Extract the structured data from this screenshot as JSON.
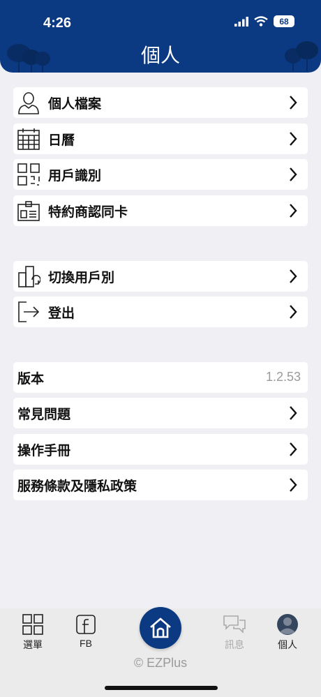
{
  "status_bar": {
    "time": "4:26",
    "battery": "68"
  },
  "header": {
    "title": "個人"
  },
  "group1": [
    {
      "label": "個人檔案",
      "icon": "person-icon"
    },
    {
      "label": "日曆",
      "icon": "calendar-icon"
    },
    {
      "label": "用戶識別",
      "icon": "qr-code-icon"
    },
    {
      "label": "特約商認同卡",
      "icon": "id-card-icon"
    }
  ],
  "group2": [
    {
      "label": "切換用戶別",
      "icon": "switch-user-icon"
    },
    {
      "label": "登出",
      "icon": "logout-icon"
    }
  ],
  "group3": {
    "version_label": "版本",
    "version_value": "1.2.53",
    "faq": "常見問題",
    "manual": "操作手冊",
    "terms": "服務條款及隱私政策"
  },
  "tabbar": {
    "menu": "選單",
    "fb": "FB",
    "messages": "訊息",
    "personal": "個人"
  },
  "footer": {
    "copyright": "© EZPlus"
  },
  "colors": {
    "brand": "#0b3a82",
    "background": "#efeff4"
  }
}
